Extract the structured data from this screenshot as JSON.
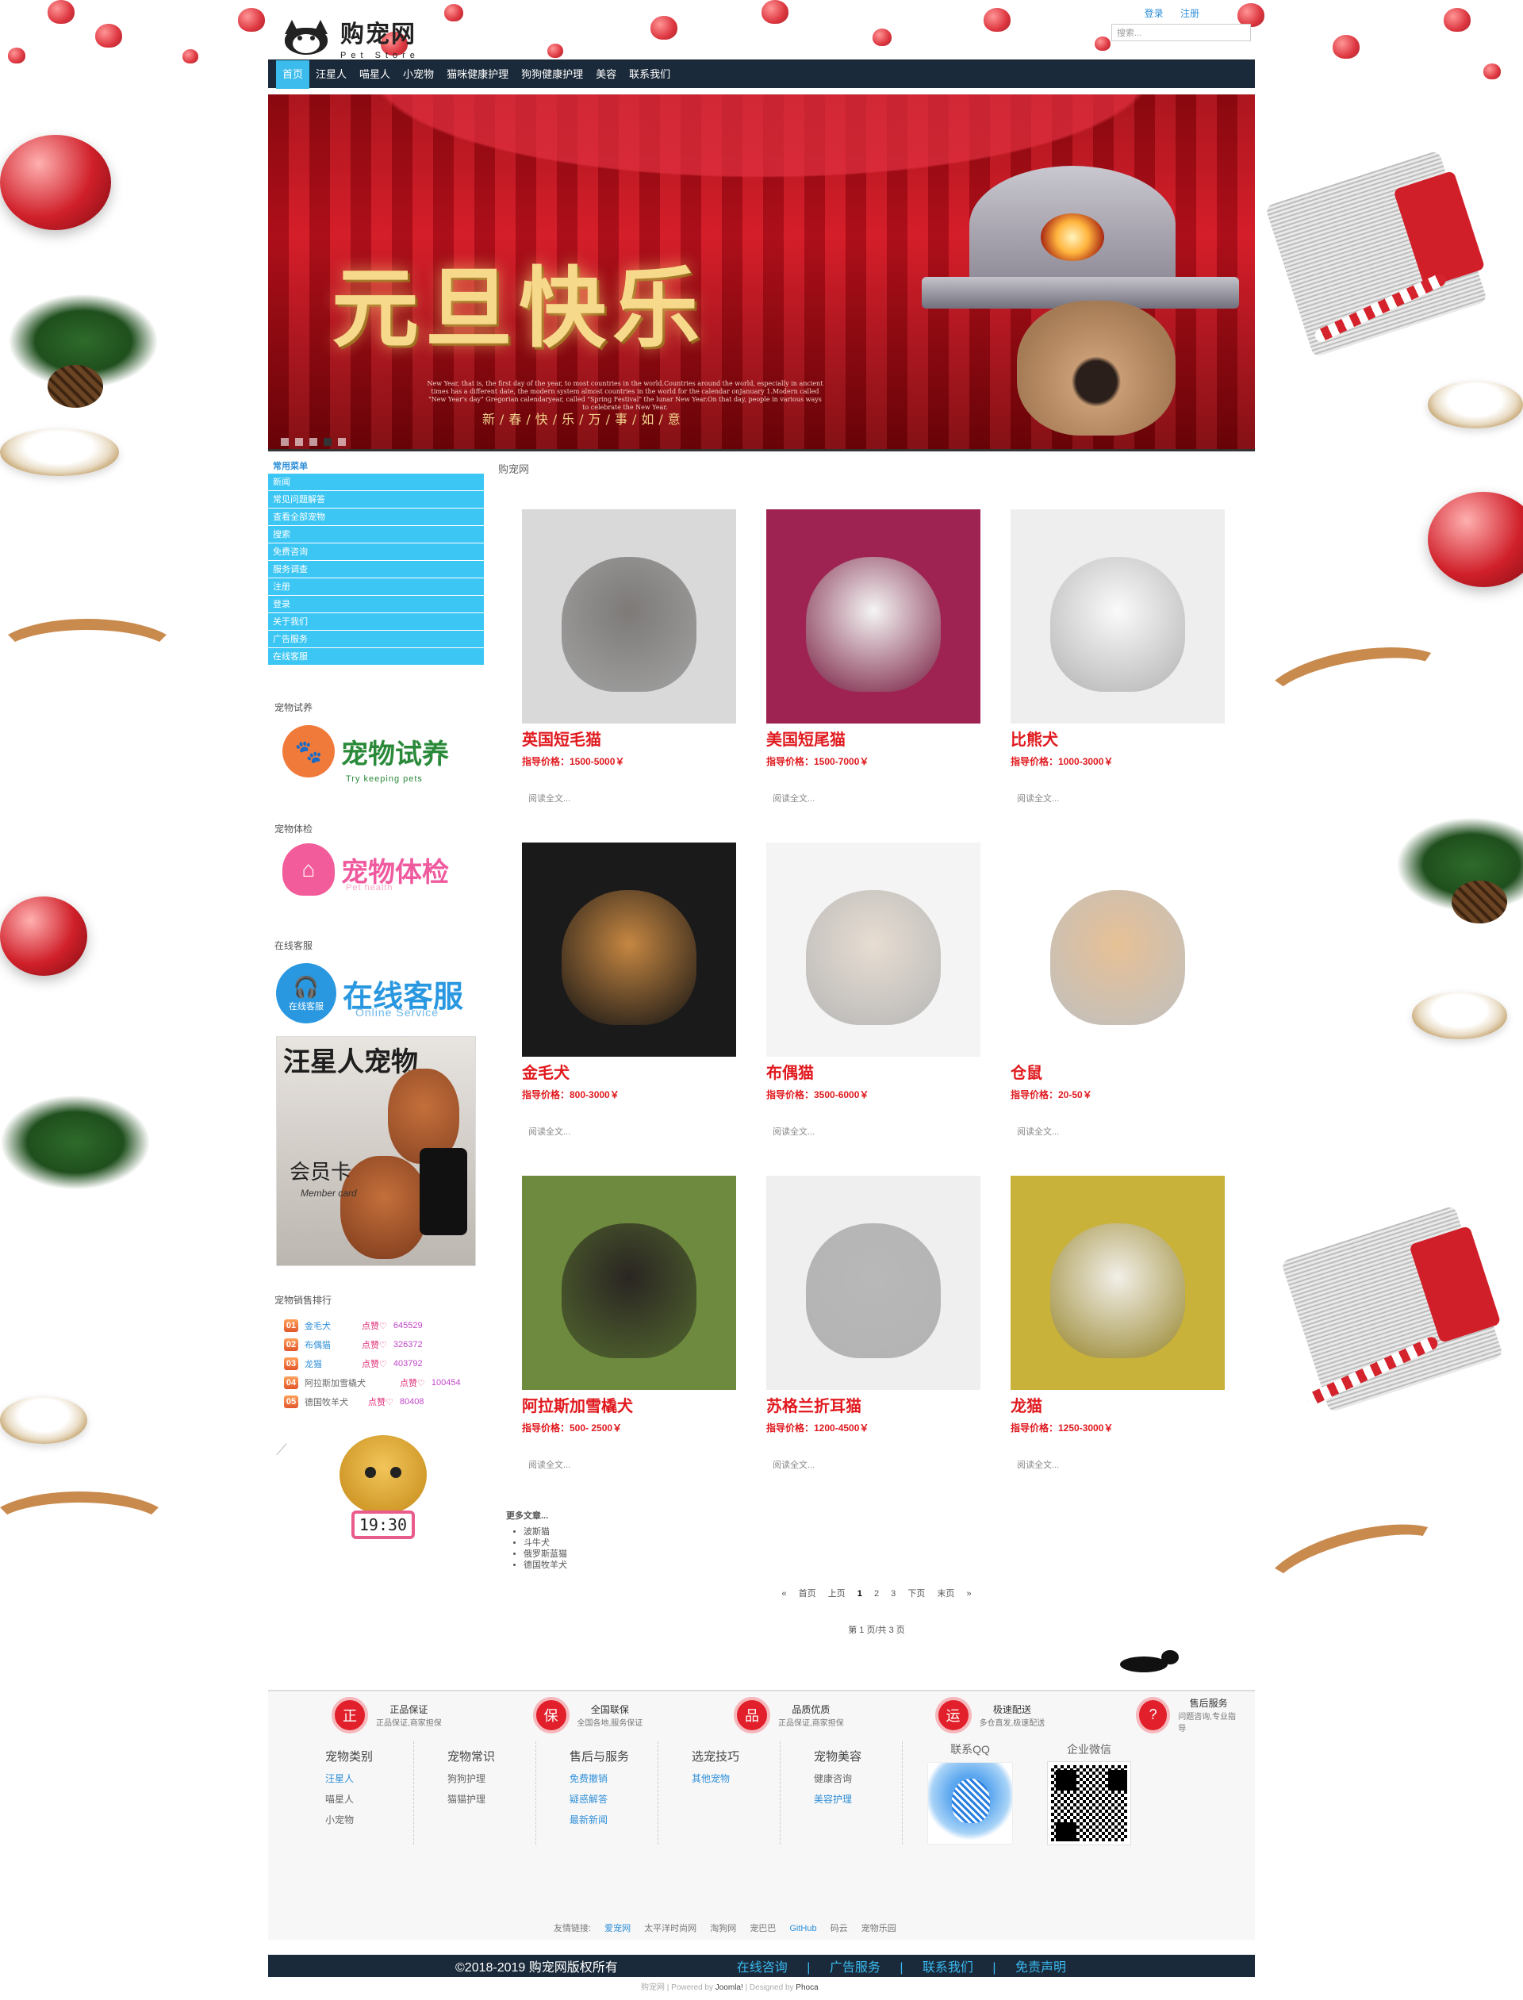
{
  "header": {
    "logo_cn": "购宠网",
    "logo_en": "Pet Store",
    "login": "登录",
    "register": "注册",
    "search_placeholder": "搜索..."
  },
  "nav": [
    "首页",
    "汪星人",
    "喵星人",
    "小宠物",
    "猫咪健康护理",
    "狗狗健康护理",
    "美容",
    "联系我们"
  ],
  "banner": {
    "title": "元旦快乐",
    "text": "New Year, that is, the first day of the year, to most countries in the world.Countries around the world, especially in ancient times has a different date, the modern system almost countries in the world for the calendar onJanuary 1.Modern called \"New Year's day\" Gregorian calendaryear, called \"Spring Festival\" the lunar New Year.On that day, people in various ways to celebrate the New Year.",
    "subtitle": "新/春/快/乐/万/事/如/意"
  },
  "sidebar": {
    "menu_title": "常用菜单",
    "menu": [
      "新闻",
      "常见问题解答",
      "查看全部宠物",
      "搜索",
      "免费咨询",
      "服务调查",
      "注册",
      "登录",
      "关于我们",
      "广告服务",
      "在线客服"
    ],
    "trial_title": "宠物试养",
    "trial_word": "宠物试养",
    "trial_sub": "Try keeping pets",
    "health_title": "宠物体检",
    "health_word": "宠物体检",
    "health_sub": "Pet health",
    "service_title": "在线客服",
    "service_word": "在线客服",
    "service_icon_text": "在线客服",
    "service_sub": "Online Service",
    "vip_title": "汪星人宠物",
    "vip_card": "会员卡",
    "vip_card_en": "Member card",
    "rank_title": "宠物销售排行",
    "rank": [
      {
        "num": "01",
        "name": "金毛犬",
        "like": "点赞♡",
        "count": "645529"
      },
      {
        "num": "02",
        "name": "布偶猫",
        "like": "点赞♡",
        "count": "326372"
      },
      {
        "num": "03",
        "name": "龙猫",
        "like": "点赞♡",
        "count": "403792"
      },
      {
        "num": "04",
        "name": "阿拉斯加雪橇犬",
        "like": "点赞♡",
        "count": "100454"
      },
      {
        "num": "05",
        "name": "德国牧羊犬",
        "like": "点赞♡",
        "count": "80408"
      }
    ],
    "clock": "19:30"
  },
  "main": {
    "breadcrumb": "购宠网",
    "read_more": "阅读全文...",
    "pets": [
      {
        "name": "英国短毛猫",
        "price": "指导价格：1500-5000￥",
        "bg": "#d9d9d9",
        "fg": "#7d7a78"
      },
      {
        "name": "美国短尾猫",
        "price": "指导价格：1500-7000￥",
        "bg": "#9e2352",
        "fg": "#f5f5f5"
      },
      {
        "name": "比熊犬",
        "price": "指导价格：1000-3000￥",
        "bg": "#eeeeee",
        "fg": "#fafafa"
      },
      {
        "name": "金毛犬",
        "price": "指导价格：800-3000￥",
        "bg": "#1a1a1a",
        "fg": "#c68742"
      },
      {
        "name": "布偶猫",
        "price": "指导价格：3500-6000￥",
        "bg": "#f4f4f4",
        "fg": "#e7ddd2"
      },
      {
        "name": "仓鼠",
        "price": "指导价格：20-50￥",
        "bg": "#ffffff",
        "fg": "#e7c196"
      },
      {
        "name": "阿拉斯加雪橇犬",
        "price": "指导价格：500- 2500￥",
        "bg": "#6e8a3e",
        "fg": "#2a2522"
      },
      {
        "name": "苏格兰折耳猫",
        "price": "指导价格：1200-4500￥",
        "bg": "#efefef",
        "fg": "#b8b8b8"
      },
      {
        "name": "龙猫",
        "price": "指导价格：1250-3000￥",
        "bg": "#c9b23a",
        "fg": "#f2efe8"
      }
    ],
    "more_title": "更多文章...",
    "more": [
      "波斯猫",
      "斗牛犬",
      "俄罗斯蓝猫",
      "德国牧羊犬"
    ],
    "pager": {
      "first": "首页",
      "prev": "上页",
      "pages": [
        "1",
        "2",
        "3"
      ],
      "next": "下页",
      "last": "末页",
      "open": "«",
      "close": "»"
    },
    "page_info": "第 1 页/共 3 页"
  },
  "footer": {
    "guarantees": [
      {
        "icon": "正",
        "title": "正品保证",
        "desc": "正品保证,商家担保"
      },
      {
        "icon": "保",
        "title": "全国联保",
        "desc": "全国各地,服务保证"
      },
      {
        "icon": "品",
        "title": "品质优质",
        "desc": "正品保证,商家担保"
      },
      {
        "icon": "运",
        "title": "极速配送",
        "desc": "多仓直发,极速配送"
      },
      {
        "icon": "?",
        "title": "售后服务",
        "desc": "问题咨询,专业指导"
      }
    ],
    "columns": [
      {
        "title": "宠物类别",
        "links": [
          {
            "t": "汪星人",
            "blue": true
          },
          {
            "t": "喵星人",
            "blue": false
          },
          {
            "t": "小宠物",
            "blue": false
          }
        ]
      },
      {
        "title": "宠物常识",
        "links": [
          {
            "t": "狗狗护理",
            "blue": false
          },
          {
            "t": "猫猫护理",
            "blue": false
          }
        ]
      },
      {
        "title": "售后与服务",
        "links": [
          {
            "t": "免费撤销",
            "blue": true
          },
          {
            "t": "疑惑解答",
            "blue": true
          },
          {
            "t": "最新新闻",
            "blue": true
          }
        ]
      },
      {
        "title": "选宠技巧",
        "links": [
          {
            "t": "其他宠物",
            "blue": true
          }
        ]
      },
      {
        "title": "宠物美容",
        "links": [
          {
            "t": "健康咨询",
            "blue": false
          },
          {
            "t": "美容护理",
            "blue": true
          }
        ]
      }
    ],
    "qq_title": "联系QQ",
    "wechat_title": "企业微信",
    "friends_label": "友情链接:",
    "friends": [
      {
        "t": "爱宠网",
        "blue": true
      },
      {
        "t": "太平洋时尚网",
        "blue": false
      },
      {
        "t": "淘狗网",
        "blue": false
      },
      {
        "t": "宠巴巴",
        "blue": false
      },
      {
        "t": "GitHub",
        "blue": true
      },
      {
        "t": "码云",
        "blue": false
      },
      {
        "t": "宠物乐园",
        "blue": false
      }
    ],
    "copyright": "©2018-2019 购宠网版权所有",
    "bottom_links": [
      "在线咨询",
      "|",
      "广告服务",
      "|",
      "联系我们",
      "|",
      "免责声明"
    ],
    "powered": {
      "site": "购宠网",
      "powered_by": "| Powered by",
      "joomla": "Joomla!",
      "designed_by": "| Designed by",
      "phoca": "Phoca"
    }
  }
}
